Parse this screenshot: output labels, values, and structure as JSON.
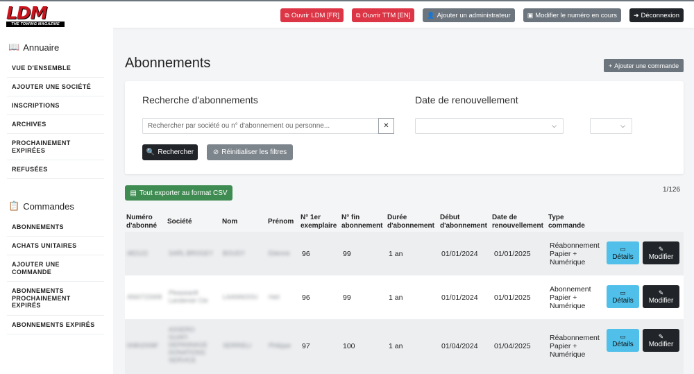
{
  "logo": {
    "main": "LDM",
    "sub": "THE TOWING MAGAZINE"
  },
  "header": {
    "buttons": [
      {
        "label": "Ouvrir LDM [FR]",
        "icon": "external-link-icon"
      },
      {
        "label": "Ouvrir TTM [EN]",
        "icon": "external-link-icon"
      },
      {
        "label": "Ajouter un administrateur",
        "icon": "user-plus-icon"
      },
      {
        "label": "Modifier le numéro en cours",
        "icon": "book-icon"
      },
      {
        "label": "Déconnexion",
        "icon": "sign-out-icon"
      }
    ]
  },
  "sidebar": {
    "annuaire": {
      "title": "Annuaire",
      "items": [
        "VUE D'ENSEMBLE",
        "AJOUTER UNE SOCIÉTÉ",
        "INSCRIPTIONS",
        "ARCHIVES",
        "PROCHAINEMENT EXPIRÉES",
        "REFUSÉES"
      ]
    },
    "commandes": {
      "title": "Commandes",
      "items": [
        "ABONNEMENTS",
        "ACHATS UNITAIRES",
        "AJOUTER UNE COMMANDE",
        "ABONNEMENTS PROCHAINEMENT EXPIRÉS",
        "ABONNEMENTS EXPIRÉS"
      ]
    }
  },
  "main": {
    "title": "Abonnements",
    "add_order": "Ajouter une commande",
    "search": {
      "title": "Recherche d'abonnements",
      "placeholder": "Rechercher par société ou n° d'abonnement ou personne...",
      "clear": "✕",
      "submit": "Rechercher",
      "reset": "Réinitialiser les filtres"
    },
    "renewal": {
      "title": "Date de renouvellement"
    },
    "export_csv": "Tout exporter au format CSV",
    "pagination": "1/126",
    "table": {
      "headers": {
        "numero": [
          "Numéro",
          "d'abonné"
        ],
        "societe": [
          "Société"
        ],
        "nom": [
          "Nom"
        ],
        "prenom": [
          "Prénom"
        ],
        "premier": [
          "N° 1er",
          "exemplaire"
        ],
        "fin": [
          "N° fin",
          "abonnement"
        ],
        "duree": [
          "Durée",
          "d'abonnement"
        ],
        "debut": [
          "Début",
          "d'abonnement"
        ],
        "renouv": [
          "Date de",
          "renouvellement"
        ],
        "type": [
          "Type",
          "commande"
        ]
      },
      "details_label": "Détails",
      "modify_label": "Modifier",
      "rows": [
        {
          "numero": "482122",
          "societe": [
            "SARL BROGEY"
          ],
          "nom": "BOUDY",
          "prenom": "Etienne",
          "premier": "96",
          "fin": "99",
          "duree": "1 an",
          "debut": "01/01/2024",
          "renouv": "01/01/2025",
          "type": [
            "Réabonnement",
            "Papier +",
            "Numérique"
          ]
        },
        {
          "numero": "4560723308",
          "societe": [
            "Pleaseanft",
            "Landemer Cie"
          ],
          "nom": "LAANNOOU",
          "prenom": "Heil",
          "premier": "96",
          "fin": "99",
          "duree": "1 an",
          "debut": "01/01/2024",
          "renouv": "01/01/2025",
          "type": [
            "Abonnement",
            "Papier +",
            "Numérique"
          ]
        },
        {
          "numero": "00802008F",
          "societe": [
            "ASSERO",
            "GUAFI",
            "DEPANNAGE",
            "DONATIONS",
            "SERVICE"
          ],
          "nom": "SERRIELI",
          "prenom": "Philippe",
          "premier": "97",
          "fin": "100",
          "duree": "1 an",
          "debut": "01/04/2024",
          "renouv": "01/04/2025",
          "type": [
            "Réabonnement",
            "Papier +",
            "Numérique"
          ]
        }
      ]
    }
  }
}
